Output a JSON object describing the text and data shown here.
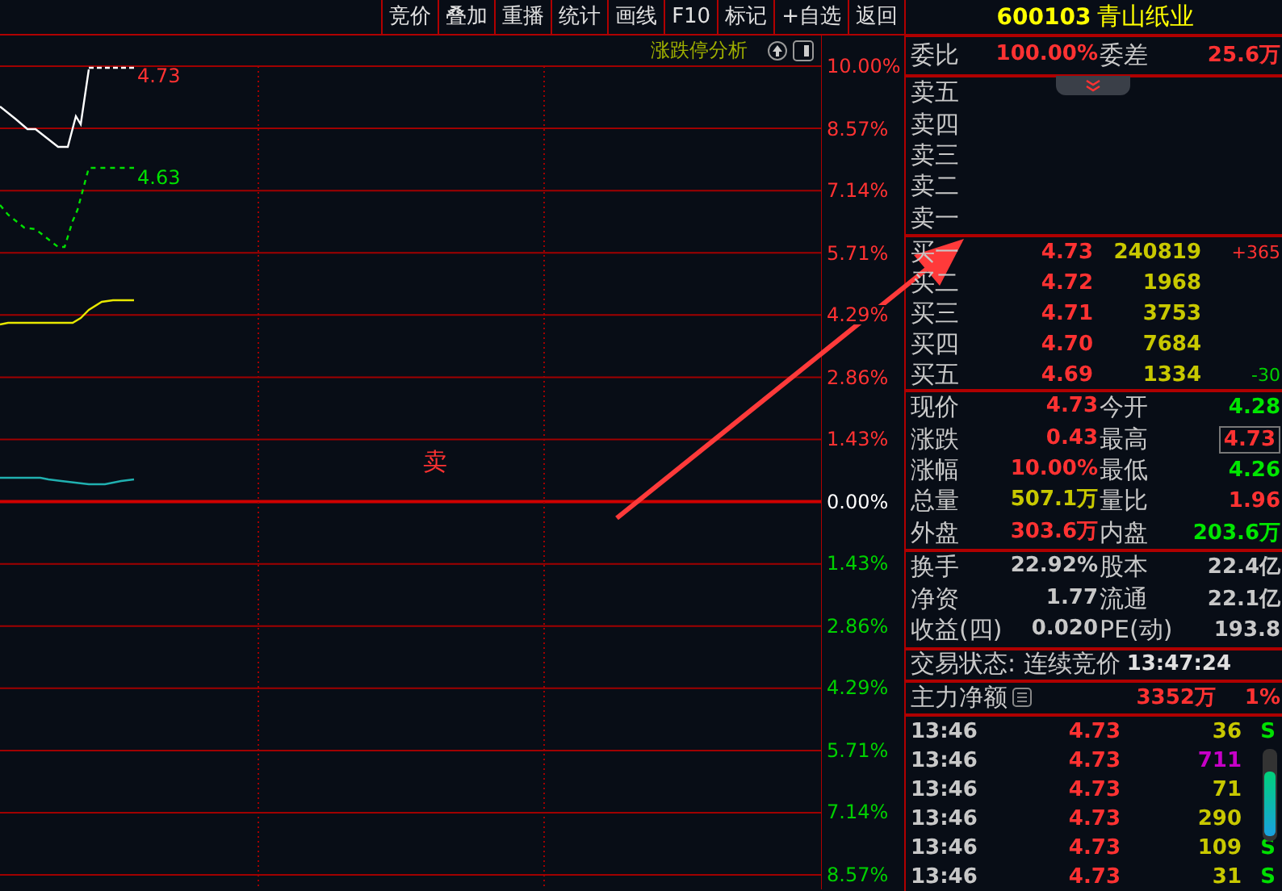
{
  "toolbar": [
    {
      "label": "竞价"
    },
    {
      "label": "叠加"
    },
    {
      "label": "重播"
    },
    {
      "label": "统计"
    },
    {
      "label": "画线"
    },
    {
      "label": "F10"
    },
    {
      "label": "标记"
    },
    {
      "label": "+自选"
    },
    {
      "label": "返回"
    }
  ],
  "chart": {
    "title": "涨跌停分析",
    "price_label": "4.73",
    "avg_label": "4.63",
    "signal": "卖",
    "axis_ticks": [
      {
        "label": "10.00%",
        "kind": "up"
      },
      {
        "label": "8.57%",
        "kind": "up"
      },
      {
        "label": "7.14%",
        "kind": "up"
      },
      {
        "label": "5.71%",
        "kind": "up"
      },
      {
        "label": "4.29%",
        "kind": "up"
      },
      {
        "label": "2.86%",
        "kind": "up"
      },
      {
        "label": "1.43%",
        "kind": "up"
      },
      {
        "label": "0.00%",
        "kind": "flat"
      },
      {
        "label": "1.43%",
        "kind": "down"
      },
      {
        "label": "2.86%",
        "kind": "down"
      },
      {
        "label": "4.29%",
        "kind": "down"
      },
      {
        "label": "5.71%",
        "kind": "down"
      },
      {
        "label": "7.14%",
        "kind": "down"
      },
      {
        "label": "8.57%",
        "kind": "down"
      }
    ]
  },
  "quote": {
    "code": "600103",
    "name": "青山纸业"
  },
  "weibi": {
    "label": "委比",
    "value": "100.00%",
    "label2": "委差",
    "value2": "25.6万"
  },
  "asks": [
    {
      "label": "卖五"
    },
    {
      "label": "卖四"
    },
    {
      "label": "卖三"
    },
    {
      "label": "卖二"
    },
    {
      "label": "卖一"
    }
  ],
  "bids": [
    {
      "label": "买一",
      "price": "4.73",
      "volume": "240819",
      "change": "+365",
      "color": "#ff3232"
    },
    {
      "label": "买二",
      "price": "4.72",
      "volume": "1968"
    },
    {
      "label": "买三",
      "price": "4.71",
      "volume": "3753"
    },
    {
      "label": "买四",
      "price": "4.70",
      "volume": "7684"
    },
    {
      "label": "买五",
      "price": "4.69",
      "volume": "1334",
      "change": "-30",
      "color": "#00d000"
    }
  ],
  "stats": [
    {
      "left": {
        "label": "现价",
        "value": "4.73",
        "color": "#ff3232"
      },
      "right": {
        "label": "今开",
        "value": "4.28",
        "color": "#00e600",
        "boxed": false
      }
    },
    {
      "left": {
        "label": "涨跌",
        "value": "0.43",
        "color": "#ff3232"
      },
      "right": {
        "label": "最高",
        "value": "4.73",
        "color": "#ff3232",
        "boxed": true
      }
    },
    {
      "left": {
        "label": "涨幅",
        "value": "10.00%",
        "color": "#ff3232"
      },
      "right": {
        "label": "最低",
        "value": "4.26",
        "color": "#00e600",
        "boxed": false
      }
    },
    {
      "left": {
        "label": "总量",
        "value": "507.1万",
        "color": "#c8c800"
      },
      "right": {
        "label": "量比",
        "value": "1.96",
        "color": "#ff3232",
        "boxed": false
      }
    },
    {
      "left": {
        "label": "外盘",
        "value": "303.6万",
        "color": "#ff3232"
      },
      "right": {
        "label": "内盘",
        "value": "203.6万",
        "color": "#00e600",
        "boxed": false
      }
    }
  ],
  "fundamentals": [
    {
      "left": {
        "label": "换手",
        "value": "22.92%"
      },
      "right": {
        "label": "股本",
        "value": "22.4亿"
      }
    },
    {
      "left": {
        "label": "净资",
        "value": "1.77"
      },
      "right": {
        "label": "流通",
        "value": "22.1亿"
      }
    },
    {
      "left": {
        "label": "收益(四)",
        "value": "0.020"
      },
      "right": {
        "label": "PE(动)",
        "value": "193.8"
      }
    }
  ],
  "status": {
    "text": "交易状态: 连续竞价",
    "time": "13:47:24"
  },
  "main_flow": {
    "label": "主力净额",
    "value": "3352万",
    "percent": "1%"
  },
  "trades": [
    {
      "time": "13:46",
      "price": "4.73",
      "volume": "36",
      "color": "#c8c800",
      "side": "S"
    },
    {
      "time": "13:46",
      "price": "4.73",
      "volume": "711",
      "color": "#c800c8"
    },
    {
      "time": "13:46",
      "price": "4.73",
      "volume": "71",
      "color": "#c8c800"
    },
    {
      "time": "13:46",
      "price": "4.73",
      "volume": "290",
      "color": "#c8c800"
    },
    {
      "time": "13:46",
      "price": "4.73",
      "volume": "109",
      "color": "#c8c800",
      "side": "S"
    },
    {
      "time": "13:46",
      "price": "4.73",
      "volume": "31",
      "color": "#c8c800",
      "side": "S"
    }
  ]
}
